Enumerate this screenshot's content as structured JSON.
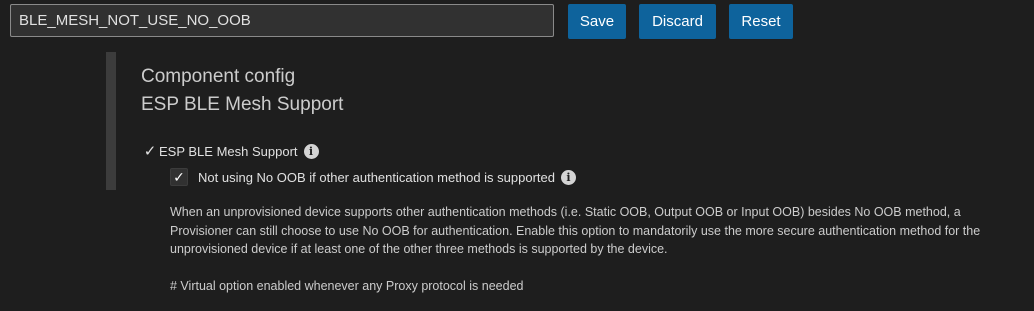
{
  "search": {
    "value": "BLE_MESH_NOT_USE_NO_OOB"
  },
  "toolbar": {
    "save_label": "Save",
    "discard_label": "Discard",
    "reset_label": "Reset"
  },
  "section": {
    "title": "Component config",
    "subtitle": "ESP BLE Mesh Support"
  },
  "options": [
    {
      "label": "ESP BLE Mesh Support",
      "checked": true,
      "check_glyph": "✓"
    },
    {
      "label": "Not using No OOB if other authentication method is supported",
      "checked": true,
      "check_glyph": "✓"
    }
  ],
  "info_glyph": "i",
  "description": {
    "text": "When an unprovisioned device supports other authentication methods (i.e. Static OOB, Output OOB or Input OOB) besides No OOB method, a Provisioner can still choose to use No OOB for authentication. Enable this option to mandatorily use the more secure authentication method for the unprovisioned device if at least one of the other three methods is supported by the device.",
    "note": "# Virtual option enabled whenever any Proxy protocol is needed"
  },
  "colors": {
    "background": "#1e1e1e",
    "button": "#0e639c",
    "button_text": "#ffffff",
    "input_border": "#8a8a8a"
  }
}
